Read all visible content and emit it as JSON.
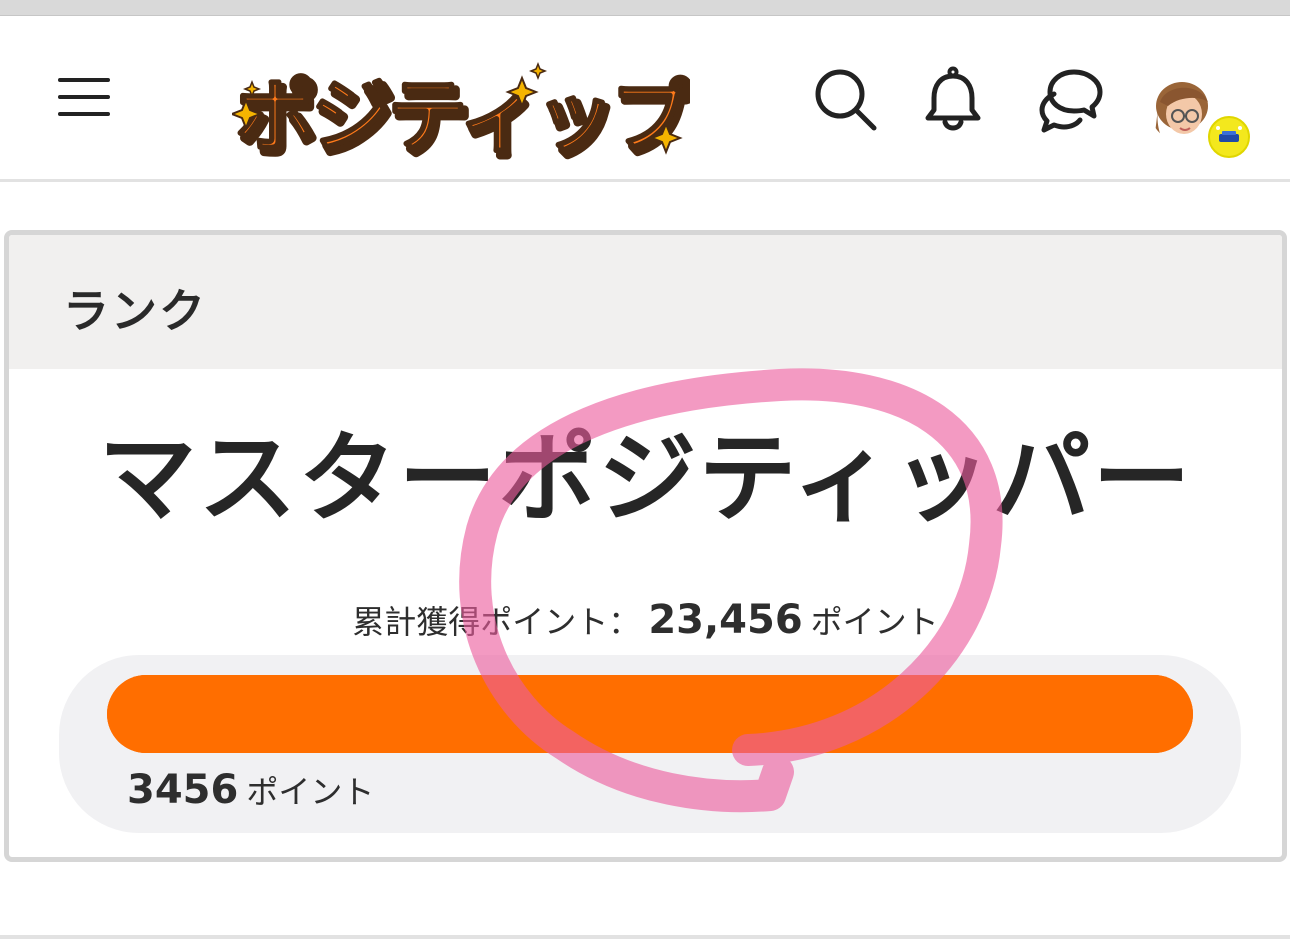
{
  "header": {
    "logo_text": "ポジティップ",
    "icons": {
      "menu": "hamburger-menu-icon",
      "search": "search-icon",
      "notifications": "bell-icon",
      "messages": "chat-bubbles-icon",
      "avatar": "user-avatar"
    }
  },
  "rank_card": {
    "title": "ランク",
    "rank_name": "マスターポジティッパー",
    "total_label": "累計獲得ポイント：",
    "total_value": "23,456",
    "total_unit": "ポイント",
    "progress": {
      "fill_fraction": 1.0,
      "current_value": "3456",
      "current_unit": "ポイント"
    }
  },
  "colors": {
    "accent": "#ff6e00",
    "logo_orange": "#ff7a1a",
    "logo_outline": "#4a2a12",
    "sparkle": "#f5b400",
    "annotation_pink": "#ec5c9c",
    "card_header_bg": "#f1f0ef",
    "progress_panel_bg": "#f1f1f3"
  }
}
